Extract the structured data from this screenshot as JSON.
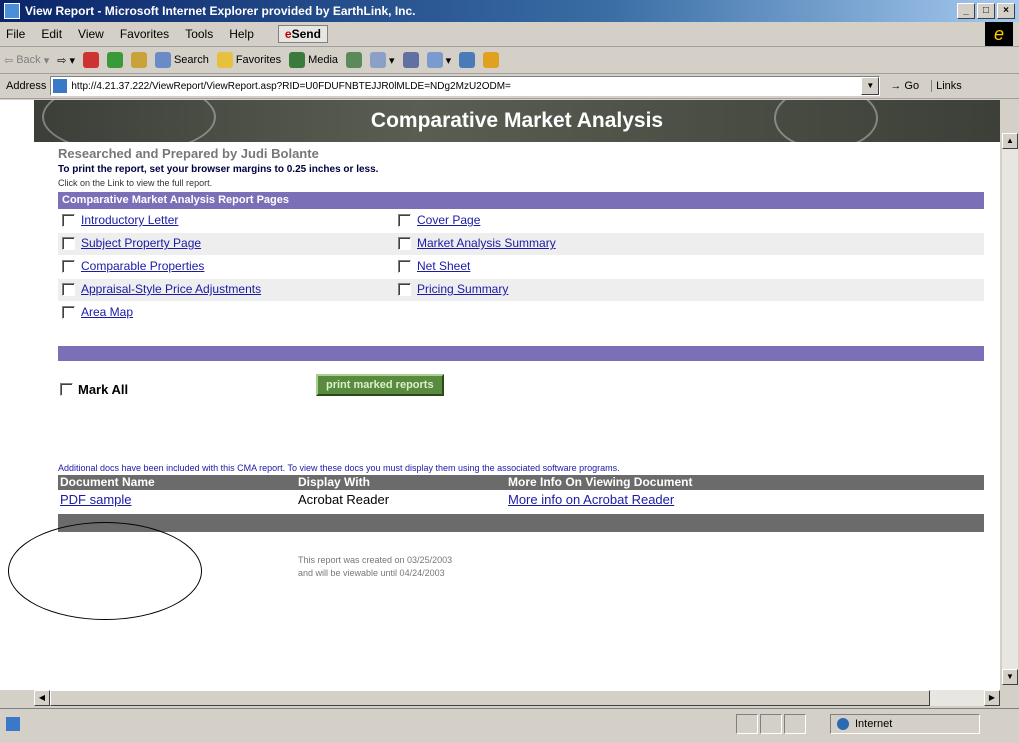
{
  "window": {
    "title": "View Report - Microsoft Internet Explorer provided by EarthLink, Inc.",
    "controls": [
      "_",
      "□",
      "×"
    ]
  },
  "menu": {
    "items": [
      "File",
      "Edit",
      "View",
      "Favorites",
      "Tools",
      "Help"
    ],
    "send_label": "Send"
  },
  "toolbar": {
    "back": "Back",
    "search": "Search",
    "favorites": "Favorites",
    "media": "Media"
  },
  "address": {
    "label": "Address",
    "url": "http://4.21.37.222/ViewReport/ViewReport.asp?RID=U0FDUFNBTEJJR0lMLDE=NDg2MzU2ODM=",
    "go_label": "Go",
    "links_label": "Links"
  },
  "report": {
    "banner_title": "Comparative Market Analysis",
    "prepared_by": "Researched and Prepared by Judi Bolante",
    "print_note": "To print the report, set your browser margins to 0.25 inches or less.",
    "click_note": "Click on the Link to view the full report.",
    "section_title": "Comparative Market Analysis Report Pages",
    "pages_left": [
      "Introductory Letter",
      "Subject Property Page",
      "Comparable Properties",
      "Appraisal-Style Price Adjustments",
      "Area Map"
    ],
    "pages_right": [
      "Cover Page",
      "Market Analysis Summary",
      "Net Sheet",
      "Pricing Summary"
    ],
    "mark_all_label": "Mark All",
    "print_button_label": "print marked reports",
    "additional_note": "Additional docs have been included with this CMA report. To view these docs you must display them using the associated software programs.",
    "doc_table": {
      "headers": [
        "Document Name",
        "Display With",
        "More Info On Viewing Document"
      ],
      "rows": [
        [
          "PDF sample",
          "Acrobat Reader",
          "More info on Acrobat Reader"
        ]
      ]
    },
    "created_line1": "This report was created on 03/25/2003",
    "created_line2": "and will be viewable until 04/24/2003"
  },
  "status": {
    "zone": "Internet"
  }
}
